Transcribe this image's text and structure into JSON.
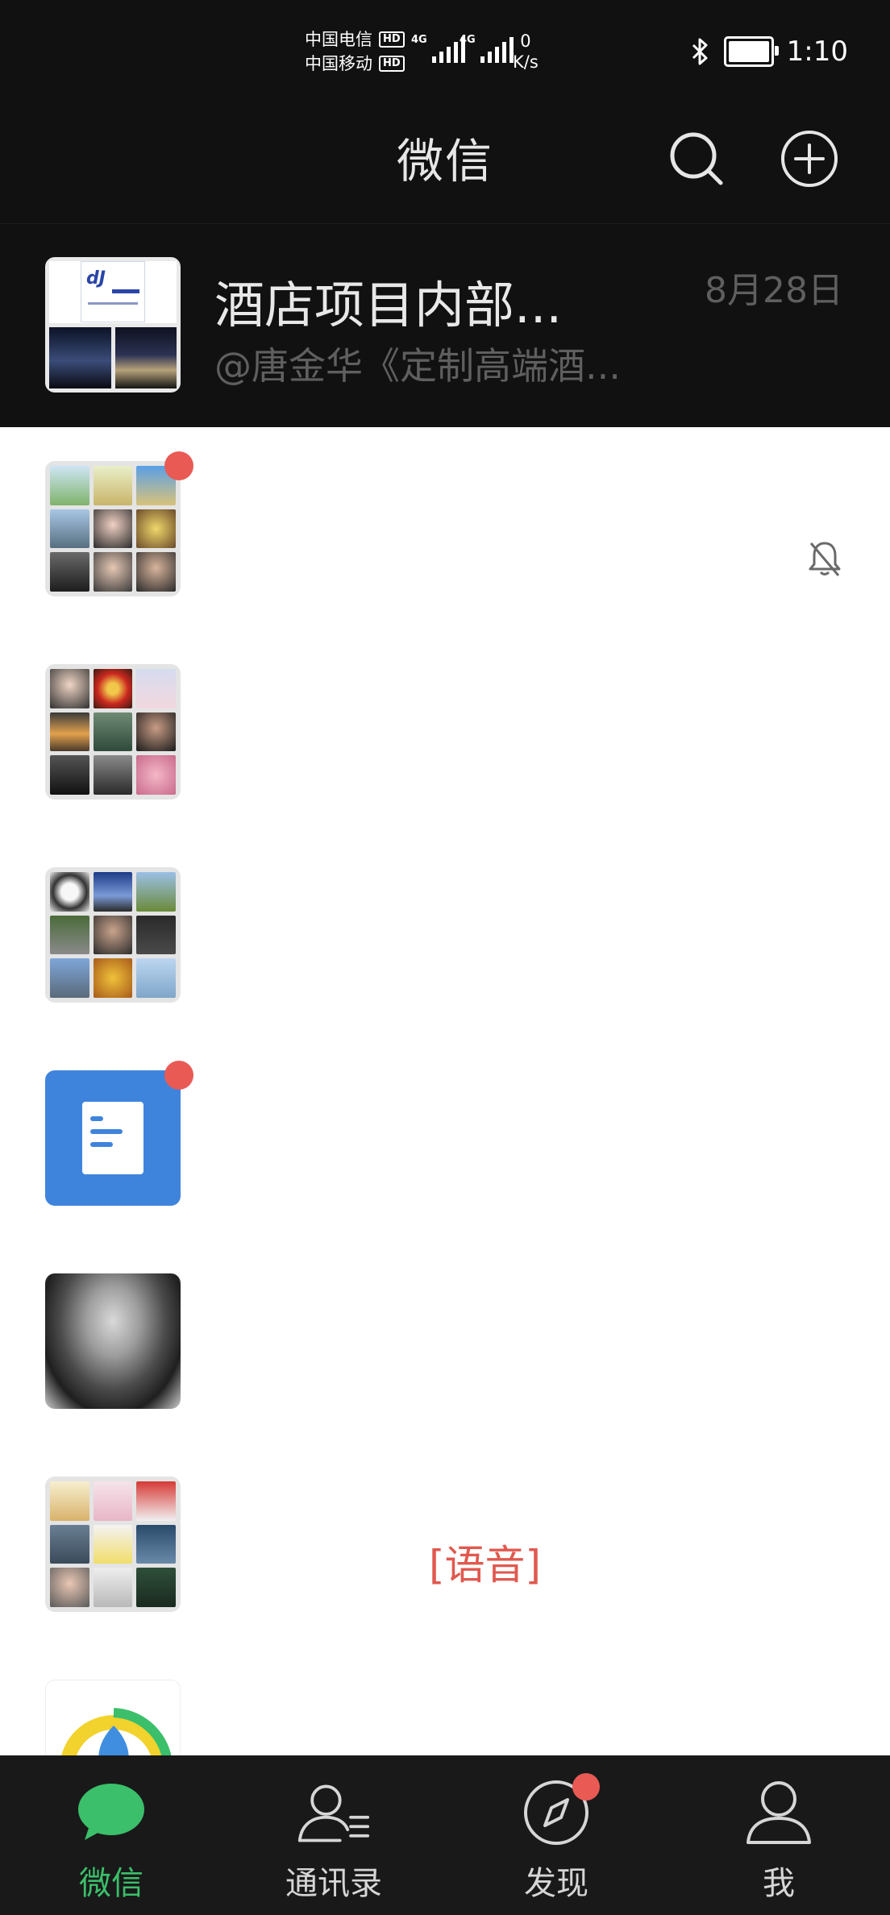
{
  "status_bar": {
    "carrier1": "中国电信",
    "carrier2": "中国移动",
    "hd": "HD",
    "network": "4G",
    "net_speed_value": "0",
    "net_speed_unit": "K/s",
    "time": "1:10",
    "battery_level": 0.9
  },
  "header": {
    "title": "微信",
    "icons": [
      "search-icon",
      "add-icon"
    ]
  },
  "pinned_chat": {
    "name": "酒店项目内部...",
    "preview": "@唐金华《定制高端酒...",
    "time": "8月28日"
  },
  "chat_list": [
    {
      "avatar": "group-grid",
      "unread_dot": true,
      "muted": true
    },
    {
      "avatar": "group-grid",
      "unread_dot": false
    },
    {
      "avatar": "group-grid",
      "unread_dot": false
    },
    {
      "avatar": "document",
      "unread_dot": true
    },
    {
      "avatar": "portrait",
      "unread_dot": false
    },
    {
      "avatar": "group-grid",
      "unread_dot": false,
      "preview_tag": "[语音]"
    },
    {
      "avatar": "logo",
      "unread_dot": false
    }
  ],
  "tabs": [
    {
      "label": "微信",
      "icon": "chat-bubble-icon",
      "active": true
    },
    {
      "label": "通讯录",
      "icon": "contacts-icon",
      "active": false
    },
    {
      "label": "发现",
      "icon": "compass-icon",
      "active": false,
      "dot": true
    },
    {
      "label": "我",
      "icon": "person-icon",
      "active": false
    }
  ],
  "colors": {
    "dark_bg": "#111111",
    "tab_bg": "#191919",
    "accent_green": "#3bbf6a",
    "badge_red": "#e95a55",
    "voice_tag_red": "#e0594f"
  }
}
